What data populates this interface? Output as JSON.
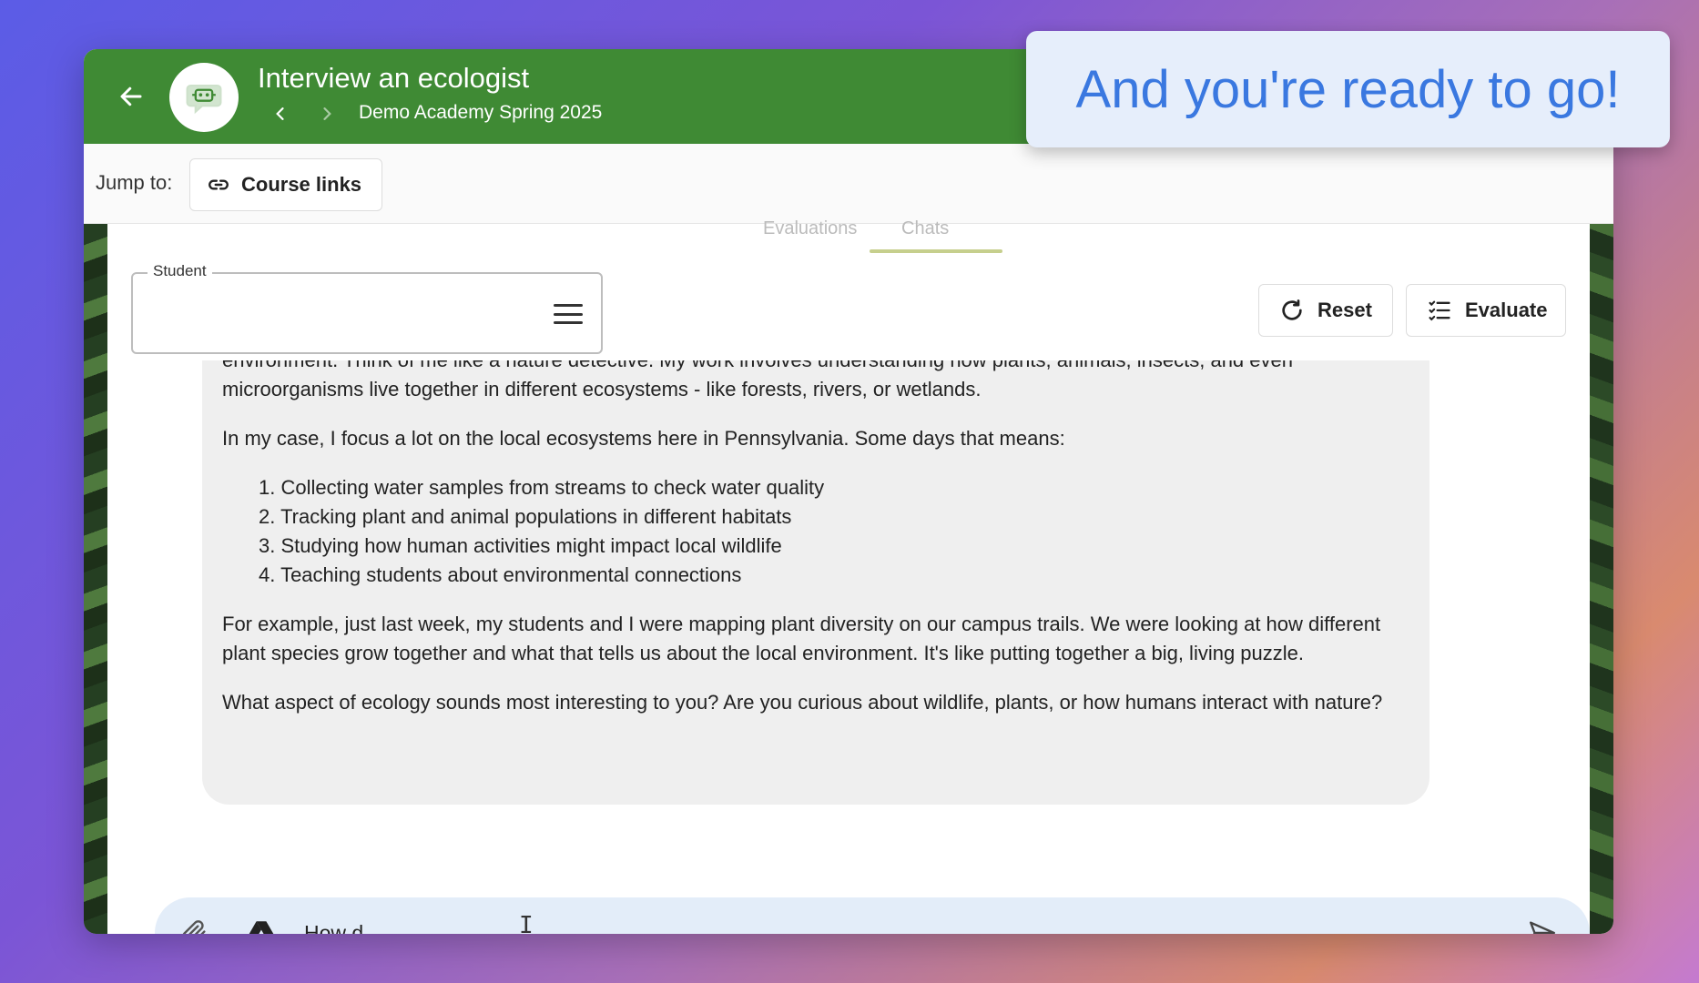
{
  "header": {
    "back_icon": "arrow-left-icon",
    "logo_icon": "chatbot-icon",
    "title": "Interview an ecologist",
    "subtitle": "Demo Academy Spring 2025",
    "color": "#3f8a34"
  },
  "jumpbar": {
    "label": "Jump to:",
    "course_links_label": "Course links"
  },
  "tabs": {
    "left_partial": "Evaluations",
    "right_partial": "Chats"
  },
  "student_field": {
    "legend": "Student",
    "value": ""
  },
  "actions": {
    "reset_label": "Reset",
    "evaluate_label": "Evaluate"
  },
  "message": {
    "partial_line": "environment. Think of me like a nature detective. My work involves understanding how plants, animals, insects, and even",
    "line2": "microorganisms live together in different ecosystems - like forests, rivers, or wetlands.",
    "para2": "In my case, I focus a lot on the local ecosystems here in Pennsylvania. Some days that means:",
    "list": [
      "1. Collecting water samples from streams to check water quality",
      "2. Tracking plant and animal populations in different habitats",
      "3. Studying how human activities might impact local wildlife",
      "4. Teaching students about environmental connections"
    ],
    "para3": "For example, just last week, my students and I were mapping plant diversity on our campus trails. We were looking at how different plant species grow together and what that tells us about the local environment. It's like putting together a big, living puzzle.",
    "para4": "What aspect of ecology sounds most interesting to you? Are you curious about wildlife, plants, or how humans interact with nature?"
  },
  "composer": {
    "value": "How d",
    "placeholder": ""
  },
  "callout": {
    "text": "And you're ready to go!"
  }
}
